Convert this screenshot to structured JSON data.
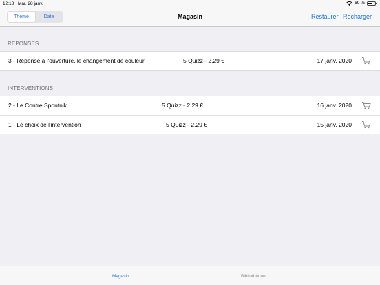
{
  "status_bar": {
    "time": "12:18",
    "date": "Mar. 28 janv.",
    "battery": "69 %",
    "battery_level": 0.69
  },
  "nav": {
    "segments": [
      {
        "label": "Thème",
        "selected": true
      },
      {
        "label": "Date",
        "selected": false
      }
    ],
    "title": "Magasin",
    "restore_label": "Restaurer",
    "reload_label": "Recharger"
  },
  "sections": [
    {
      "header": "REPONSES",
      "rows": [
        {
          "title": "3 - Réponse à l'ouverture, le changement de couleur",
          "price": "5 Quizz - 2,29 €",
          "date": "17 janv. 2020",
          "icon": "cart-icon"
        }
      ]
    },
    {
      "header": "INTERVENTIONS",
      "rows": [
        {
          "title": "2 - Le Contre Spoutnik",
          "price": "5 Quizz - 2,29 €",
          "date": "16 janv. 2020",
          "icon": "cart-icon"
        },
        {
          "title": "1 - Le choix de l'intervention",
          "price": "5 Quizz - 2,29 €",
          "date": "15 janv. 2020",
          "icon": "cart-icon"
        }
      ]
    }
  ],
  "tabs": [
    {
      "label": "Magasin",
      "active": true
    },
    {
      "label": "Bibliothèque",
      "active": false
    }
  ],
  "colors": {
    "accent": "#1a73e8",
    "background": "#efeff4",
    "section_text": "#6d6d72"
  }
}
